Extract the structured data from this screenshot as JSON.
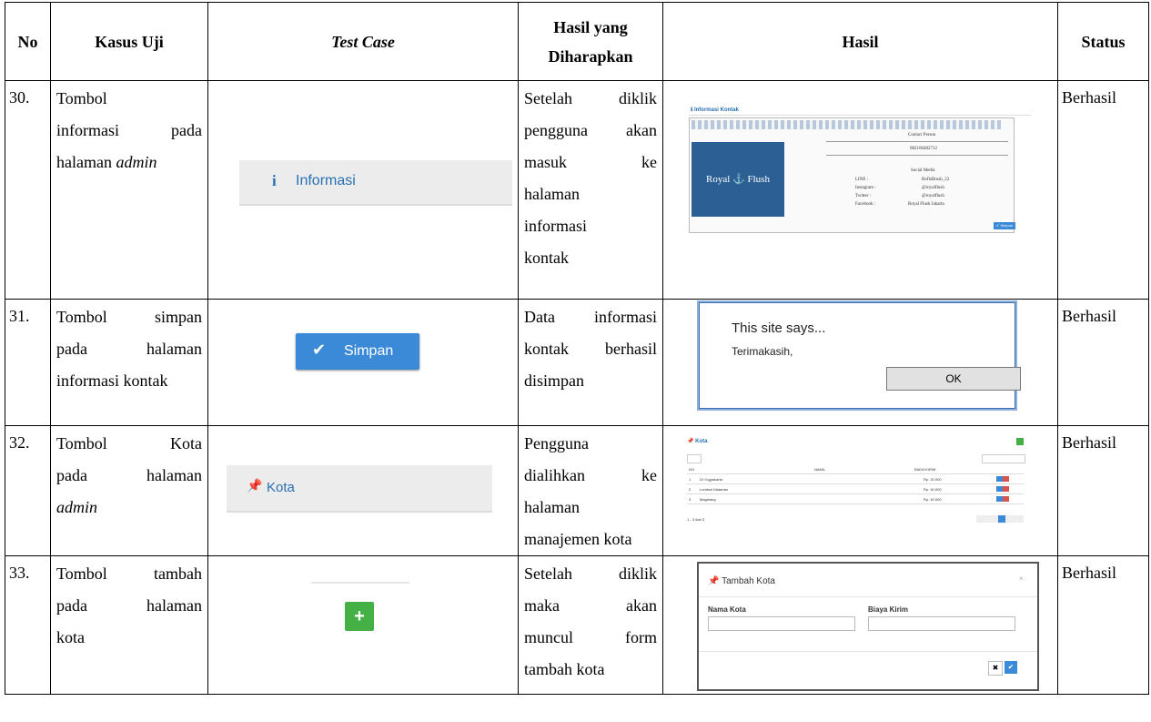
{
  "header": {
    "no": "No",
    "kasus_uji": "Kasus Uji",
    "test_case": "Test Case",
    "hasil_diharapkan_1": "Hasil yang",
    "hasil_diharapkan_2": "Diharapkan",
    "hasil": "Hasil",
    "status": "Status"
  },
  "rows": [
    {
      "no": "30.",
      "kasus_lines": [
        "Tombol",
        "informasi pada",
        "halaman admin"
      ],
      "button": {
        "icon": "info-icon",
        "label": "Informasi"
      },
      "expected_lines": [
        "Setelah diklik",
        "pengguna akan",
        "masuk ke",
        "halaman",
        "informasi",
        "kontak"
      ],
      "result": {
        "title": "Informasi Kontak",
        "logo": "Royal Flush",
        "contact_person": "Contact Person",
        "phone": "082106482712",
        "social_media": "Social Media",
        "line_label": "LINE :",
        "line_value": "RoflsBrush_22",
        "instagram_label": "Instagram :",
        "instagram_value": "@royalflush",
        "twitter_label": "Twitter :",
        "twitter_value": "@royalflush",
        "facebook_label": "Facebook :",
        "facebook_value": "Royal Flush Jakarta",
        "submit": "Simpan"
      },
      "status": "Berhasil"
    },
    {
      "no": "31.",
      "kasus_lines": [
        "Tombol simpan",
        "pada halaman",
        "informasi kontak"
      ],
      "button": {
        "icon": "check-icon",
        "label": "Simpan"
      },
      "expected_lines": [
        "Data informasi",
        "kontak berhasil",
        "disimpan"
      ],
      "result": {
        "heading": "This site says...",
        "message": "Terimakasih,",
        "ok": "OK"
      },
      "status": "Berhasil"
    },
    {
      "no": "32.",
      "kasus_lines": [
        "Tombol Kota",
        "pada halaman",
        "admin"
      ],
      "button": {
        "icon": "pin-icon",
        "label": "Kota"
      },
      "expected_lines": [
        "Pengguna",
        "dialihkan ke",
        "halaman",
        "manajemen kota"
      ],
      "result": {
        "title": "Kota",
        "col_no": "NO",
        "col_nama": "NAMA",
        "col_biaya": "BIAYA KIRIM",
        "rows": [
          {
            "no": "1",
            "nama": "DI Yogyakarta",
            "biaya": "Rp. 20.000"
          },
          {
            "no": "2",
            "nama": "Lombok Mataram",
            "biaya": "Rp. 40.000"
          },
          {
            "no": "3",
            "nama": "Magelang",
            "biaya": "Rp. 40.000"
          }
        ],
        "footer": "1 - 3 dari 3"
      },
      "status": "Berhasil"
    },
    {
      "no": "33.",
      "kasus_lines": [
        "Tombol tambah",
        "pada halaman",
        "kota"
      ],
      "button": {
        "icon": "plus-icon",
        "label": "+"
      },
      "expected_lines": [
        "Setelah diklik",
        "maka akan",
        "muncul form",
        "tambah kota"
      ],
      "result": {
        "title": "Tambah Kota",
        "close": "×",
        "label_nama": "Nama Kota",
        "label_biaya": "Biaya Kirim",
        "cancel": "✖",
        "save": "✔"
      },
      "status": "Berhasil"
    }
  ]
}
